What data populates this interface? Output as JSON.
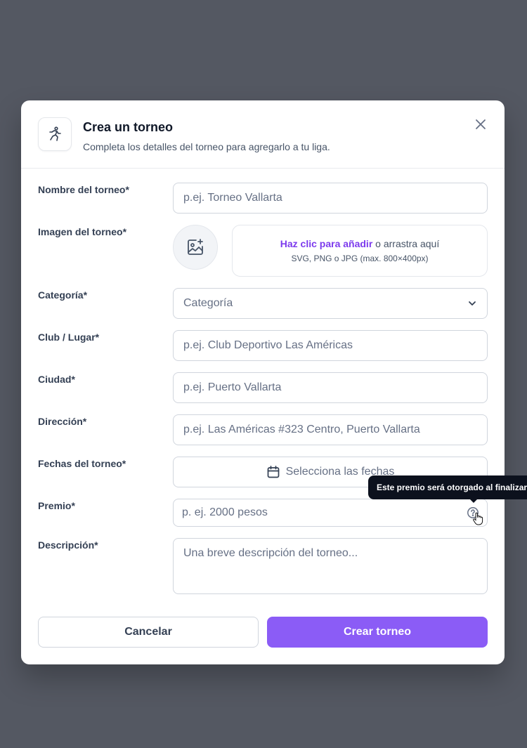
{
  "modal": {
    "title": "Crea un torneo",
    "subtitle": "Completa los detalles del torneo para agregarlo a tu liga."
  },
  "fields": {
    "name": {
      "label": "Nombre del torneo*",
      "placeholder": "p.ej. Torneo Vallarta"
    },
    "image": {
      "label": "Imagen del torneo*",
      "upload_link": "Haz clic para añadir",
      "upload_rest": " o arrastra aquí",
      "upload_hint": "SVG, PNG o JPG (max. 800×400px)"
    },
    "category": {
      "label": "Categoría*",
      "selected": "Categoría"
    },
    "club": {
      "label": "Club / Lugar*",
      "placeholder": "p.ej. Club Deportivo Las Américas"
    },
    "city": {
      "label": "Ciudad*",
      "placeholder": "p.ej. Puerto Vallarta"
    },
    "address": {
      "label": "Dirección*",
      "placeholder": "p.ej. Las Américas #323 Centro, Puerto Vallarta"
    },
    "dates": {
      "label": "Fechas del torneo*",
      "button": "Selecciona las fechas"
    },
    "prize": {
      "label": "Premio*",
      "placeholder": "p. ej. 2000 pesos",
      "tooltip": "Este premio será otorgado al finalizar"
    },
    "description": {
      "label": "Descripción*",
      "placeholder": "Una breve descripción del torneo..."
    }
  },
  "actions": {
    "cancel": "Cancelar",
    "create": "Crear torneo"
  },
  "colors": {
    "accent": "#8b5cf6",
    "link": "#7c3aed",
    "backdrop": "#545862",
    "tooltip_bg": "#0c111d"
  },
  "icons": {
    "header": "running-person-icon",
    "close": "close-icon",
    "image_placeholder": "image-plus-icon",
    "select": "chevron-down-icon",
    "calendar": "calendar-icon",
    "help": "help-circle-icon",
    "cursor": "hand-cursor-icon"
  }
}
